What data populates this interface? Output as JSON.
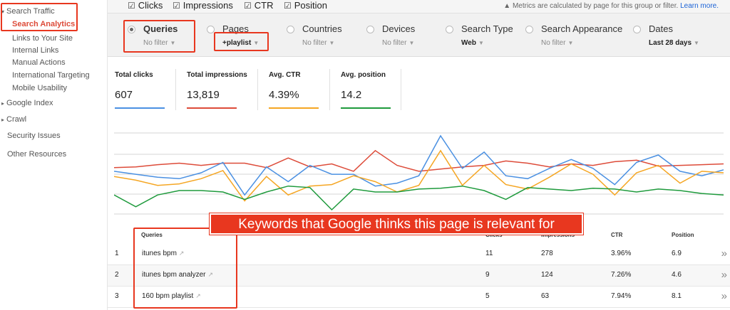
{
  "sidebar": {
    "search_traffic": "Search Traffic",
    "items": [
      {
        "label": "Search Analytics",
        "active": true
      },
      {
        "label": "Links to Your Site"
      },
      {
        "label": "Internal Links"
      },
      {
        "label": "Manual Actions"
      },
      {
        "label": "International Targeting"
      },
      {
        "label": "Mobile Usability"
      }
    ],
    "google_index": "Google Index",
    "crawl": "Crawl",
    "security_issues": "Security Issues",
    "other_resources": "Other Resources"
  },
  "metric_toggles": [
    {
      "label": "Clicks",
      "checked": true
    },
    {
      "label": "Impressions",
      "checked": true
    },
    {
      "label": "CTR",
      "checked": true
    },
    {
      "label": "Position",
      "checked": true
    }
  ],
  "note": {
    "icon": "warning-icon",
    "text": "Metrics are calculated by page for this group or filter.",
    "link": "Learn more."
  },
  "filters": [
    {
      "label": "Queries",
      "value": "No filter",
      "selected": true
    },
    {
      "label": "Pages",
      "value": "+playlist",
      "selected": false
    },
    {
      "label": "Countries",
      "value": "No filter",
      "selected": false
    },
    {
      "label": "Devices",
      "value": "No filter",
      "selected": false
    },
    {
      "label": "Search Type",
      "value": "Web",
      "selected": false
    },
    {
      "label": "Search Appearance",
      "value": "No filter",
      "selected": false
    },
    {
      "label": "Dates",
      "value": "Last 28 days",
      "selected": false
    }
  ],
  "totals": [
    {
      "label": "Total clicks",
      "value": "607",
      "color": "#4a90e2"
    },
    {
      "label": "Total impressions",
      "value": "13,819",
      "color": "#dd4b39"
    },
    {
      "label": "Avg. CTR",
      "value": "4.39%",
      "color": "#f5a623"
    },
    {
      "label": "Avg. position",
      "value": "14.2",
      "color": "#1e9a3c"
    }
  ],
  "chart_data": {
    "type": "line",
    "x_count": 29,
    "grid": true,
    "series": [
      {
        "color": "#dd4b39",
        "values": [
          0.57,
          0.58,
          0.61,
          0.63,
          0.6,
          0.63,
          0.63,
          0.57,
          0.7,
          0.58,
          0.62,
          0.52,
          0.8,
          0.6,
          0.52,
          0.55,
          0.58,
          0.6,
          0.66,
          0.63,
          0.58,
          0.62,
          0.6,
          0.65,
          0.67,
          0.59,
          0.6,
          0.61,
          0.62
        ]
      },
      {
        "color": "#4a90e2",
        "values": [
          0.52,
          0.48,
          0.44,
          0.42,
          0.5,
          0.64,
          0.2,
          0.58,
          0.38,
          0.6,
          0.48,
          0.48,
          0.32,
          0.36,
          0.46,
          1.0,
          0.56,
          0.78,
          0.46,
          0.42,
          0.56,
          0.68,
          0.56,
          0.34,
          0.64,
          0.74,
          0.52,
          0.46,
          0.54
        ]
      },
      {
        "color": "#f5a623",
        "values": [
          0.45,
          0.4,
          0.33,
          0.35,
          0.42,
          0.53,
          0.12,
          0.45,
          0.2,
          0.32,
          0.34,
          0.46,
          0.38,
          0.24,
          0.33,
          0.8,
          0.33,
          0.6,
          0.34,
          0.28,
          0.44,
          0.62,
          0.48,
          0.2,
          0.5,
          0.6,
          0.36,
          0.52,
          0.5
        ]
      },
      {
        "color": "#1e9a3c",
        "values": [
          0.2,
          0.04,
          0.2,
          0.26,
          0.26,
          0.24,
          0.14,
          0.24,
          0.32,
          0.3,
          0.0,
          0.28,
          0.24,
          0.24,
          0.28,
          0.29,
          0.32,
          0.26,
          0.14,
          0.3,
          0.28,
          0.26,
          0.29,
          0.28,
          0.24,
          0.28,
          0.26,
          0.22,
          0.2
        ]
      }
    ]
  },
  "annotation": "Keywords that Google thinks this page is relevant for",
  "table": {
    "headers": [
      "Queries",
      "Clicks",
      "Impressions",
      "CTR",
      "Position"
    ],
    "rows": [
      {
        "idx": "1",
        "query": "itunes bpm",
        "clicks": "11",
        "impressions": "278",
        "ctr": "3.96%",
        "position": "6.9"
      },
      {
        "idx": "2",
        "query": "itunes bpm analyzer",
        "clicks": "9",
        "impressions": "124",
        "ctr": "7.26%",
        "position": "4.6"
      },
      {
        "idx": "3",
        "query": "160 bpm playlist",
        "clicks": "5",
        "impressions": "63",
        "ctr": "7.94%",
        "position": "8.1"
      }
    ]
  }
}
